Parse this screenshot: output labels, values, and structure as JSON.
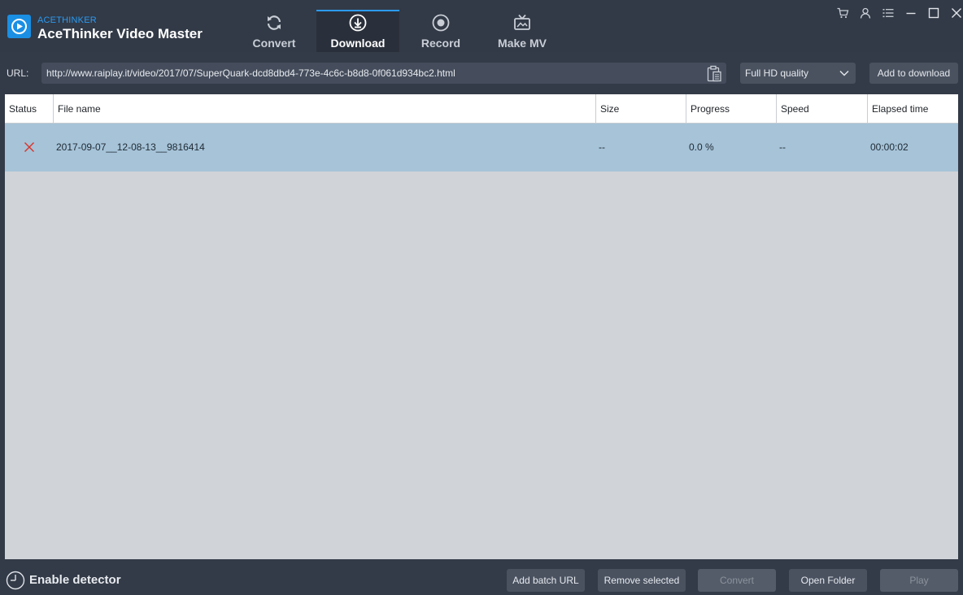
{
  "app": {
    "brand_small": "ACETHINKER",
    "title": "AceThinker Video Master"
  },
  "tabs": [
    {
      "label": "Convert",
      "icon": "refresh-icon",
      "active": false
    },
    {
      "label": "Download",
      "icon": "download-icon",
      "active": true
    },
    {
      "label": "Record",
      "icon": "record-icon",
      "active": false
    },
    {
      "label": "Make MV",
      "icon": "tv-icon",
      "active": false
    }
  ],
  "window_controls": [
    "cart-icon",
    "user-icon",
    "menu-icon",
    "minimize-icon",
    "maximize-icon",
    "close-icon"
  ],
  "url_bar": {
    "label": "URL:",
    "value": "http://www.raiplay.it/video/2017/07/SuperQuark-dcd8dbd4-773e-4c6c-b8d8-0f061d934bc2.html",
    "paste_icon": "clipboard-icon",
    "quality": "Full HD quality",
    "add_button": "Add to download"
  },
  "table": {
    "columns": [
      "Status",
      "File name",
      "Size",
      "Progress",
      "Speed",
      "Elapsed time"
    ],
    "rows": [
      {
        "status": "failed",
        "status_icon": "error-x-icon",
        "file_name": "2017-09-07__12-08-13__9816414",
        "size": "--",
        "progress": "0.0 %",
        "speed": "--",
        "elapsed": "00:00:02"
      }
    ]
  },
  "footer": {
    "detector_label": "Enable detector",
    "buttons": {
      "add_batch": "Add batch URL",
      "remove_selected": "Remove selected",
      "convert": "Convert",
      "open_folder": "Open Folder",
      "play": "Play"
    }
  },
  "colors": {
    "accent": "#2b9af0",
    "background": "#333b48",
    "selected_row": "#a6c3d8",
    "error": "#d9342b"
  }
}
